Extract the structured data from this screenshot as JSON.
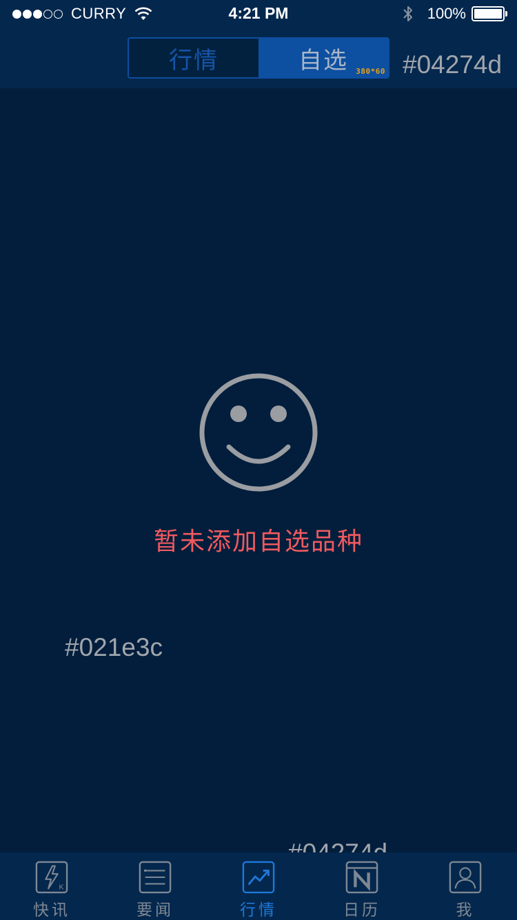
{
  "status_bar": {
    "carrier": "CURRY",
    "time": "4:21 PM",
    "battery_percent": "100%",
    "signal_strength": 3,
    "signal_max": 5
  },
  "nav": {
    "segments": [
      {
        "label": "行情",
        "active": false
      },
      {
        "label": "自选",
        "active": true
      }
    ],
    "segment_size_note": "380*60",
    "color_note": "#04274d"
  },
  "empty_state": {
    "icon": "smile-icon",
    "message": "暂未添加自选品种"
  },
  "background_color_note": "#021e3c",
  "tab_bar": {
    "color_note": "#04274d",
    "items": [
      {
        "label": "快讯",
        "icon": "lightning-k-icon",
        "active": false
      },
      {
        "label": "要闻",
        "icon": "list-icon",
        "active": false
      },
      {
        "label": "行情",
        "icon": "trend-chart-icon",
        "active": true
      },
      {
        "label": "日历",
        "icon": "calendar-n-icon",
        "active": false
      },
      {
        "label": "我",
        "icon": "user-icon",
        "active": false
      }
    ]
  },
  "colors": {
    "nav_bg": "#04274d",
    "page_bg": "#021e3c",
    "accent": "#0d4fa0",
    "empty_text": "#f05a5f",
    "active_tab": "#1f78d8",
    "inactive_tab": "#7e8894"
  }
}
